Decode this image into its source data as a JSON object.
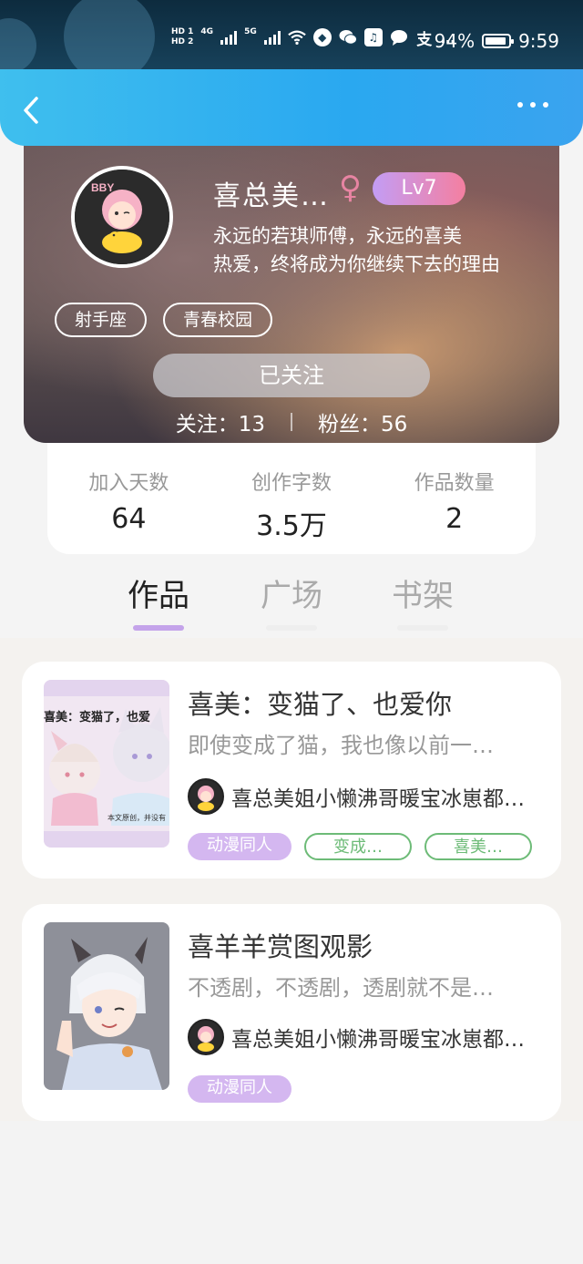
{
  "status_bar": {
    "hd1": "HD 1",
    "hd2": "HD 2",
    "net1": "4G",
    "net2": "5G",
    "more": "…",
    "battery": "94%",
    "time": "9:59"
  },
  "profile": {
    "nickname": "喜总美…",
    "gender_symbol": "♀",
    "level": "Lv7",
    "bio_line1": "永远的若琪师傅，永远的喜美",
    "bio_line2": "热爱，终将成为你继续下去的理由",
    "tags": [
      "射手座",
      "青春校园"
    ],
    "follow_button": "已关注",
    "following_label": "关注：",
    "following_count": "13",
    "fans_label": "粉丝：",
    "fans_count": "56"
  },
  "stats": [
    {
      "label": "加入天数",
      "value": "64"
    },
    {
      "label": "创作字数",
      "value": "3.5万"
    },
    {
      "label": "作品数量",
      "value": "2"
    }
  ],
  "tabs": [
    {
      "label": "作品",
      "active": true
    },
    {
      "label": "广场",
      "active": false
    },
    {
      "label": "书架",
      "active": false
    }
  ],
  "works": [
    {
      "title": "喜美：变猫了、也爱你",
      "desc": "即使变成了猫，我也像以前一…",
      "cover_caption": "喜美：变猫了，也爱",
      "cover_note": "本文原创，并没有",
      "author": "喜总美姐小懒沸哥暖宝冰崽都…",
      "tags": [
        "动漫同人",
        "变成…",
        "喜美…"
      ]
    },
    {
      "title": "喜羊羊赏图观影",
      "desc": "不透剧，不透剧，透剧就不是…",
      "author": "喜总美姐小懒沸哥暖宝冰崽都…",
      "tags": [
        "动漫同人"
      ]
    }
  ],
  "colors": {
    "nav_blue": "#2aa8f0",
    "tab_accent": "#c4a3ea",
    "tag_purple": "#d4b7f0",
    "tag_green": "#6dbb77",
    "level_gradient_start": "#c39df5",
    "level_gradient_end": "#f47fa0"
  }
}
